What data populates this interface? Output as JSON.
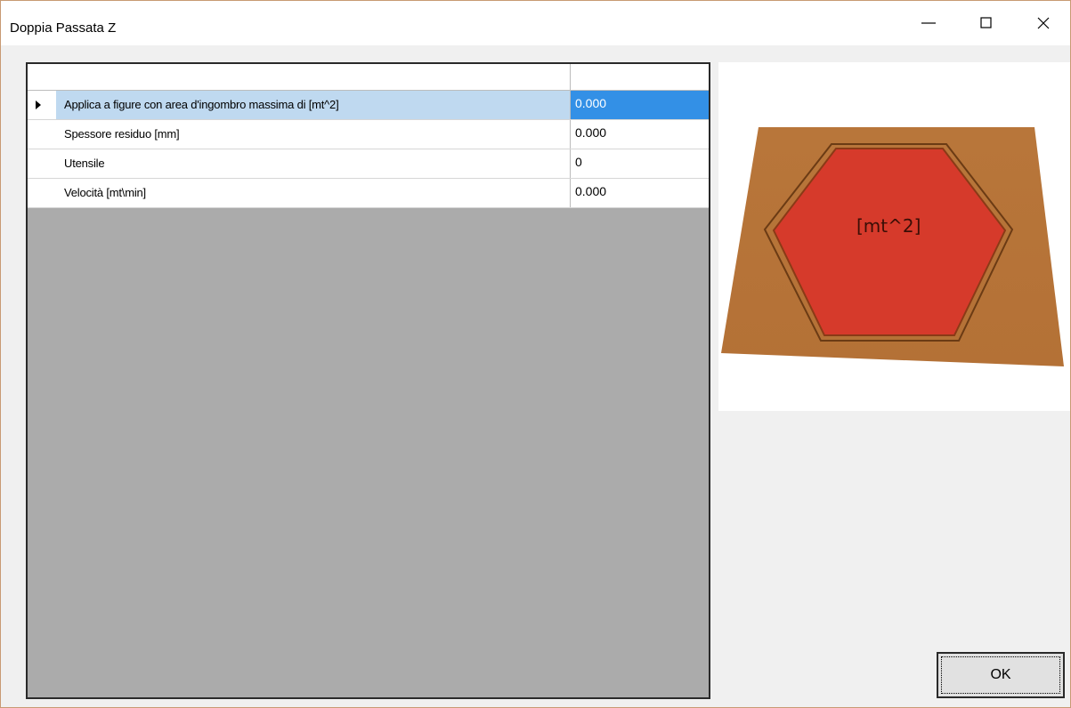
{
  "window": {
    "title": "Doppia Passata Z",
    "minimize_icon": "minimize-icon",
    "maximize_icon": "maximize-icon",
    "close_icon": "close-icon"
  },
  "grid": {
    "header": {
      "name": "",
      "value": ""
    },
    "rows": [
      {
        "label": "Applica a figure con area d'ingombro massima di [mt^2]",
        "value": "0.000",
        "selected": true
      },
      {
        "label": "Spessore residuo [mm]",
        "value": "0.000",
        "selected": false
      },
      {
        "label": "Utensile",
        "value": "0",
        "selected": false
      },
      {
        "label": "Velocità [mt\\min]",
        "value": "0.000",
        "selected": false
      }
    ]
  },
  "preview": {
    "label": "[mt^2]",
    "board_color": "#b5753a",
    "shape_color": "#d83a2a"
  },
  "buttons": {
    "ok_label": "OK"
  }
}
